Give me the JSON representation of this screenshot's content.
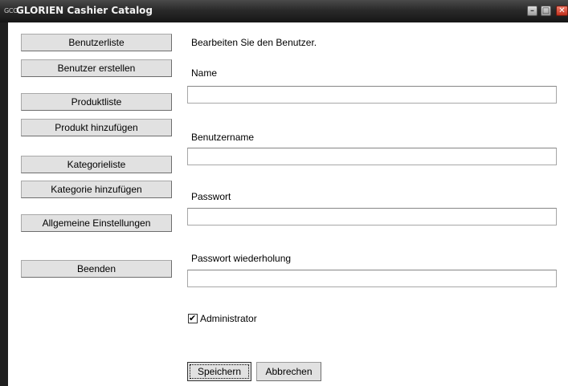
{
  "window": {
    "icon_text": "GCC",
    "title": "GLORIEN Cashier Catalog",
    "controls": {
      "minimize": "–",
      "maximize": "□",
      "close": "✕"
    }
  },
  "sidebar": {
    "buttons": [
      "Benutzerliste",
      "Benutzer erstellen",
      "Produktliste",
      "Produkt hinzufügen",
      "Kategorieliste",
      "Kategorie hinzufügen",
      "Allgemeine Einstellungen",
      "Beenden"
    ]
  },
  "form": {
    "heading": "Bearbeiten Sie den Benutzer.",
    "name_label": "Name",
    "name_value": "",
    "username_label": "Benutzername",
    "username_value": "",
    "password_label": "Passwort",
    "password_value": "",
    "password_repeat_label": "Passwort wiederholung",
    "password_repeat_value": "",
    "admin_label": "Administrator",
    "admin_checked": true,
    "save_label": "Speichern",
    "cancel_label": "Abbrechen"
  }
}
